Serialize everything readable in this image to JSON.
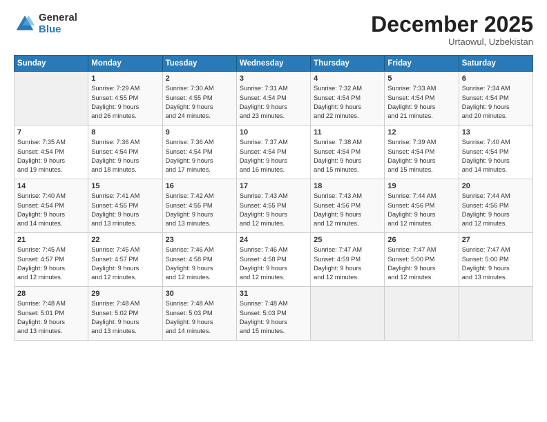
{
  "header": {
    "logo_general": "General",
    "logo_blue": "Blue",
    "month": "December 2025",
    "location": "Urtaowul, Uzbekistan"
  },
  "days_of_week": [
    "Sunday",
    "Monday",
    "Tuesday",
    "Wednesday",
    "Thursday",
    "Friday",
    "Saturday"
  ],
  "weeks": [
    [
      {
        "day": "",
        "info": ""
      },
      {
        "day": "1",
        "info": "Sunrise: 7:29 AM\nSunset: 4:55 PM\nDaylight: 9 hours\nand 26 minutes."
      },
      {
        "day": "2",
        "info": "Sunrise: 7:30 AM\nSunset: 4:55 PM\nDaylight: 9 hours\nand 24 minutes."
      },
      {
        "day": "3",
        "info": "Sunrise: 7:31 AM\nSunset: 4:54 PM\nDaylight: 9 hours\nand 23 minutes."
      },
      {
        "day": "4",
        "info": "Sunrise: 7:32 AM\nSunset: 4:54 PM\nDaylight: 9 hours\nand 22 minutes."
      },
      {
        "day": "5",
        "info": "Sunrise: 7:33 AM\nSunset: 4:54 PM\nDaylight: 9 hours\nand 21 minutes."
      },
      {
        "day": "6",
        "info": "Sunrise: 7:34 AM\nSunset: 4:54 PM\nDaylight: 9 hours\nand 20 minutes."
      }
    ],
    [
      {
        "day": "7",
        "info": "Sunrise: 7:35 AM\nSunset: 4:54 PM\nDaylight: 9 hours\nand 19 minutes."
      },
      {
        "day": "8",
        "info": "Sunrise: 7:36 AM\nSunset: 4:54 PM\nDaylight: 9 hours\nand 18 minutes."
      },
      {
        "day": "9",
        "info": "Sunrise: 7:36 AM\nSunset: 4:54 PM\nDaylight: 9 hours\nand 17 minutes."
      },
      {
        "day": "10",
        "info": "Sunrise: 7:37 AM\nSunset: 4:54 PM\nDaylight: 9 hours\nand 16 minutes."
      },
      {
        "day": "11",
        "info": "Sunrise: 7:38 AM\nSunset: 4:54 PM\nDaylight: 9 hours\nand 15 minutes."
      },
      {
        "day": "12",
        "info": "Sunrise: 7:39 AM\nSunset: 4:54 PM\nDaylight: 9 hours\nand 15 minutes."
      },
      {
        "day": "13",
        "info": "Sunrise: 7:40 AM\nSunset: 4:54 PM\nDaylight: 9 hours\nand 14 minutes."
      }
    ],
    [
      {
        "day": "14",
        "info": "Sunrise: 7:40 AM\nSunset: 4:54 PM\nDaylight: 9 hours\nand 14 minutes."
      },
      {
        "day": "15",
        "info": "Sunrise: 7:41 AM\nSunset: 4:55 PM\nDaylight: 9 hours\nand 13 minutes."
      },
      {
        "day": "16",
        "info": "Sunrise: 7:42 AM\nSunset: 4:55 PM\nDaylight: 9 hours\nand 13 minutes."
      },
      {
        "day": "17",
        "info": "Sunrise: 7:43 AM\nSunset: 4:55 PM\nDaylight: 9 hours\nand 12 minutes."
      },
      {
        "day": "18",
        "info": "Sunrise: 7:43 AM\nSunset: 4:56 PM\nDaylight: 9 hours\nand 12 minutes."
      },
      {
        "day": "19",
        "info": "Sunrise: 7:44 AM\nSunset: 4:56 PM\nDaylight: 9 hours\nand 12 minutes."
      },
      {
        "day": "20",
        "info": "Sunrise: 7:44 AM\nSunset: 4:56 PM\nDaylight: 9 hours\nand 12 minutes."
      }
    ],
    [
      {
        "day": "21",
        "info": "Sunrise: 7:45 AM\nSunset: 4:57 PM\nDaylight: 9 hours\nand 12 minutes."
      },
      {
        "day": "22",
        "info": "Sunrise: 7:45 AM\nSunset: 4:57 PM\nDaylight: 9 hours\nand 12 minutes."
      },
      {
        "day": "23",
        "info": "Sunrise: 7:46 AM\nSunset: 4:58 PM\nDaylight: 9 hours\nand 12 minutes."
      },
      {
        "day": "24",
        "info": "Sunrise: 7:46 AM\nSunset: 4:58 PM\nDaylight: 9 hours\nand 12 minutes."
      },
      {
        "day": "25",
        "info": "Sunrise: 7:47 AM\nSunset: 4:59 PM\nDaylight: 9 hours\nand 12 minutes."
      },
      {
        "day": "26",
        "info": "Sunrise: 7:47 AM\nSunset: 5:00 PM\nDaylight: 9 hours\nand 12 minutes."
      },
      {
        "day": "27",
        "info": "Sunrise: 7:47 AM\nSunset: 5:00 PM\nDaylight: 9 hours\nand 13 minutes."
      }
    ],
    [
      {
        "day": "28",
        "info": "Sunrise: 7:48 AM\nSunset: 5:01 PM\nDaylight: 9 hours\nand 13 minutes."
      },
      {
        "day": "29",
        "info": "Sunrise: 7:48 AM\nSunset: 5:02 PM\nDaylight: 9 hours\nand 13 minutes."
      },
      {
        "day": "30",
        "info": "Sunrise: 7:48 AM\nSunset: 5:03 PM\nDaylight: 9 hours\nand 14 minutes."
      },
      {
        "day": "31",
        "info": "Sunrise: 7:48 AM\nSunset: 5:03 PM\nDaylight: 9 hours\nand 15 minutes."
      },
      {
        "day": "",
        "info": ""
      },
      {
        "day": "",
        "info": ""
      },
      {
        "day": "",
        "info": ""
      }
    ]
  ]
}
